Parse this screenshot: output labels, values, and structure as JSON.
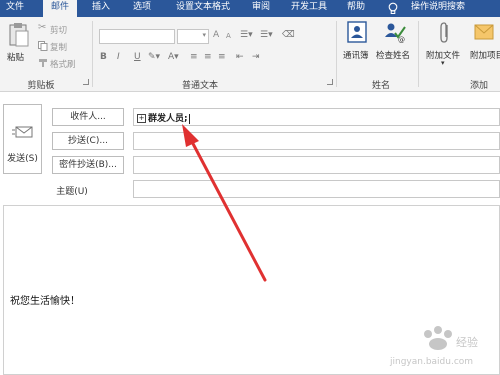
{
  "tabs": [
    {
      "label": "文件",
      "active": false
    },
    {
      "label": "邮件",
      "active": true
    },
    {
      "label": "插入",
      "active": false
    },
    {
      "label": "选项",
      "active": false
    },
    {
      "label": "设置文本格式",
      "active": false
    },
    {
      "label": "审阅",
      "active": false
    },
    {
      "label": "开发工具",
      "active": false
    },
    {
      "label": "帮助",
      "active": false
    },
    {
      "label": "操作说明搜索",
      "active": false
    }
  ],
  "ribbon": {
    "clipboard": {
      "paste": "粘贴",
      "cut": "剪切",
      "copy": "复制",
      "format_painter": "格式刷",
      "group": "剪贴板"
    },
    "basic_text": {
      "group": "普通文本",
      "grow": "A",
      "shrink": "A",
      "bold": "B",
      "italic": "I",
      "underline": "U"
    },
    "names": {
      "address_book": "通讯簿",
      "check_names": "检查姓名",
      "group": "姓名"
    },
    "include": {
      "attach_file": "附加文件",
      "attach_item": "附加项目",
      "group": "添加"
    }
  },
  "compose": {
    "send": "发送(S)",
    "to_button": "收件人...",
    "cc_button": "抄送(C)...",
    "bcc_button": "密件抄送(B)...",
    "subject_label": "主题(U)",
    "to_value": "群发人员;",
    "cc_value": "",
    "bcc_value": "",
    "subject_value": "",
    "body": "祝您生活愉快！"
  },
  "colors": {
    "accent": "#2b579a",
    "arrow": "#e03131"
  },
  "icons": [
    "paste-icon",
    "cut-icon",
    "copy-icon",
    "format-painter-icon",
    "address-book-icon",
    "check-names-icon",
    "attach-file-icon",
    "attach-item-icon",
    "send-icon",
    "lightbulb-icon"
  ]
}
